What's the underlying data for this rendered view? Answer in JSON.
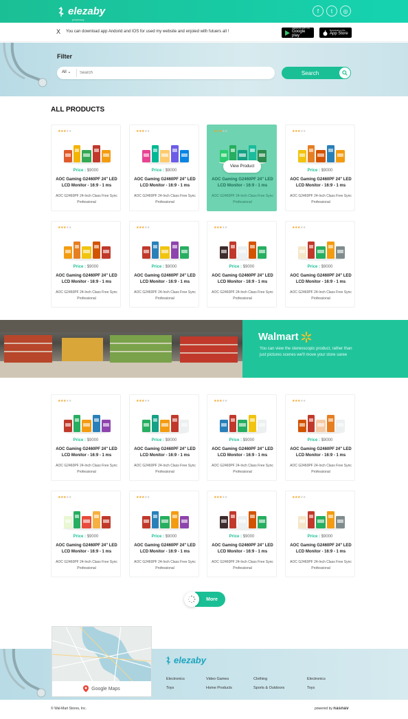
{
  "header": {
    "logo_text": "elezaby",
    "logo_sub": "pharmacy",
    "social": [
      {
        "icon": "facebook-icon",
        "glyph": "f"
      },
      {
        "icon": "twitter-icon",
        "glyph": "t"
      },
      {
        "icon": "instagram-icon",
        "glyph": "◎"
      }
    ]
  },
  "notice": {
    "close": "X",
    "message": "You can download app Andorid and IOS for used my website and enjoied with futuers all !",
    "google_small": "ANDROID APP ON",
    "google_big": "Google play",
    "apple_small": "Download on the",
    "apple_big": "App Store"
  },
  "filter": {
    "title": "Filter",
    "category": "All",
    "search_placeholder": "Search",
    "search_button": "Search"
  },
  "products_title": "ALL PRODUCTS",
  "product_common": {
    "price_label": "Price :",
    "price": "$9000",
    "name": "AOC Gaming G2460PF 24\" LED LCD Monitor - 16:9 - 1 ms",
    "desc": "AOC G2460PF 24-Inch Class Free Sync Professional",
    "view_button": "View Product"
  },
  "products": [
    {
      "p": "$9000"
    },
    {
      "p": "$9000"
    },
    {
      "p": "$9000"
    },
    {
      "p": "$9000"
    },
    {
      "p": "$9000"
    },
    {
      "p": "$9000"
    },
    {
      "p": "$9000"
    },
    {
      "p": "$9000"
    },
    {
      "p": "$9000"
    },
    {
      "p": "$9000"
    },
    {
      "p": "$9000"
    },
    {
      "p": "$9000"
    },
    {
      "p": "$9000"
    },
    {
      "p": "$9000"
    },
    {
      "p": "$9000"
    },
    {
      "p": "$9000"
    }
  ],
  "banner": {
    "brand": "Walmart",
    "text": "You can view the stereoscopic product, rather than just pictures scenes we'll move your store saree"
  },
  "more_button": "More",
  "footer": {
    "logo_text": "elezaby",
    "map_label": "Google Maps",
    "links": [
      [
        "Electronics",
        "Toys"
      ],
      [
        "Video Games",
        "Home Products"
      ],
      [
        "Clothing",
        "Sports & Outdoors"
      ],
      [
        "Electronics",
        "Toys"
      ]
    ],
    "copyright": "© Wal-Mart Stores, Inc.",
    "powered_label": "powered by",
    "powered_brand": "nasnav"
  },
  "colors": {
    "accent": "#1bbf95",
    "highlight_card": "#6ed3b0"
  }
}
